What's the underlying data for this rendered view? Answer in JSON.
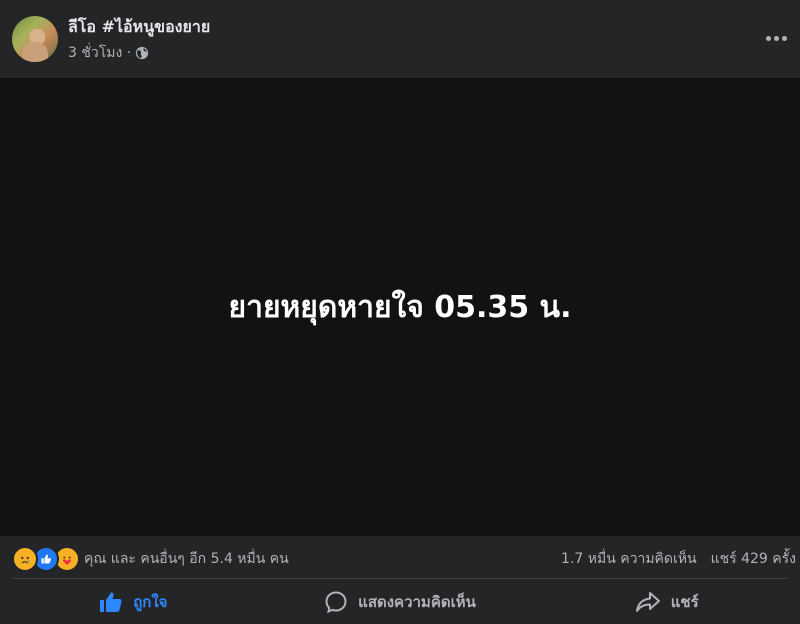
{
  "post": {
    "author": "ลีโอ #ไอ้หนูของยาย",
    "time": "3 ชั่วโมง ·",
    "privacy_icon": "globe-icon",
    "message": "ยายหยุดหายใจ 05.35 น."
  },
  "reactions": {
    "icons": [
      "sad-emoji-icon",
      "like-icon",
      "care-emoji-icon"
    ],
    "summary": "คุณ และ คนอื่นๆ อีก 5.4 หมื่น คน",
    "comments": "1.7 หมื่น ความคิดเห็น",
    "shares": "แชร์ 429 ครั้ง"
  },
  "actions": {
    "like_label": "ถูกใจ",
    "comment_label": "แสดงความคิดเห็น",
    "share_label": "แชร์"
  },
  "colors": {
    "background": "#242526",
    "post_background": "#121213",
    "accent": "#2d88ff",
    "muted_text": "#b0b3b8"
  }
}
